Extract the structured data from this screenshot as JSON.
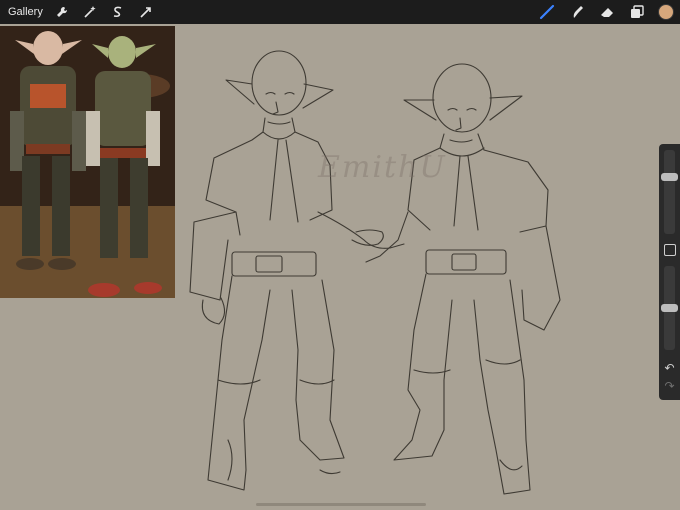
{
  "topbar": {
    "gallery_label": "Gallery",
    "left_tools": [
      "wrench-icon",
      "magic-wand-icon",
      "selection-icon",
      "transform-icon"
    ],
    "right_tools": [
      "brush-icon",
      "smudge-icon",
      "eraser-icon",
      "layers-icon"
    ],
    "current_color": "#d6a77c"
  },
  "canvas": {
    "background": "#a9a295",
    "watermark": "EmithU"
  },
  "sidebar": {
    "brush_size_level": 0.3,
    "opacity_level": 0.5
  }
}
